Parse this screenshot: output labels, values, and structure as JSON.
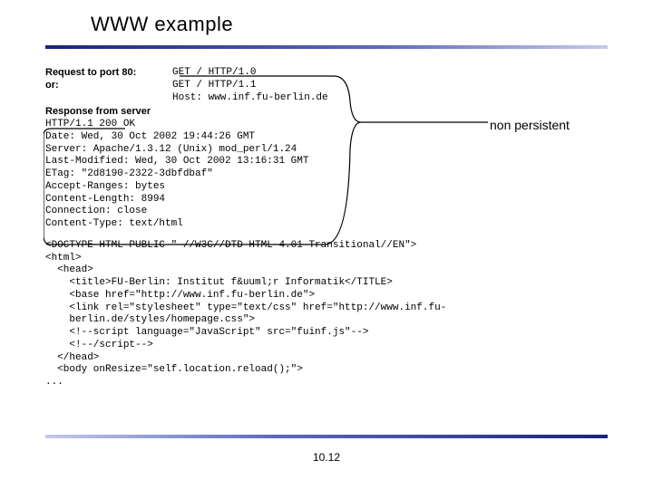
{
  "title": "WWW example",
  "request_label": "Request to port 80:",
  "or_label": "or:",
  "request_lines": [
    "GET / HTTP/1.0",
    "GET / HTTP/1.1",
    "Host: www.inf.fu-berlin.de"
  ],
  "response_label": "Response from server",
  "response_headers": [
    "HTTP/1.1 200 OK",
    "Date: Wed, 30 Oct 2002 19:44:26 GMT",
    "Server: Apache/1.3.12 (Unix) mod_perl/1.24",
    "Last-Modified: Wed, 30 Oct 2002 13:16:31 GMT",
    "ETag: \"2d8190-2322-3dbfdbaf\"",
    "Accept-Ranges: bytes",
    "Content-Length: 8994",
    "Connection: close",
    "Content-Type: text/html"
  ],
  "html_body": [
    "<DOCTYPE HTML PUBLIC \"-//W3C//DTD HTML 4.01 Transitional//EN\">",
    "<html>",
    "  <head>",
    "    <title>FU-Berlin: Institut f&uuml;r Informatik</TITLE>",
    "    <base href=\"http://www.inf.fu-berlin.de\">",
    "    <link rel=\"stylesheet\" type=\"text/css\" href=\"http://www.inf.fu-",
    "    berlin.de/styles/homepage.css\">",
    "    <!--script language=\"JavaScript\" src=\"fuinf.js\"-->",
    "    <!--/script-->",
    "  </head>",
    "",
    "  <body onResize=\"self.location.reload();\">",
    "..."
  ],
  "callout": "non persistent",
  "page_number": "10.12"
}
